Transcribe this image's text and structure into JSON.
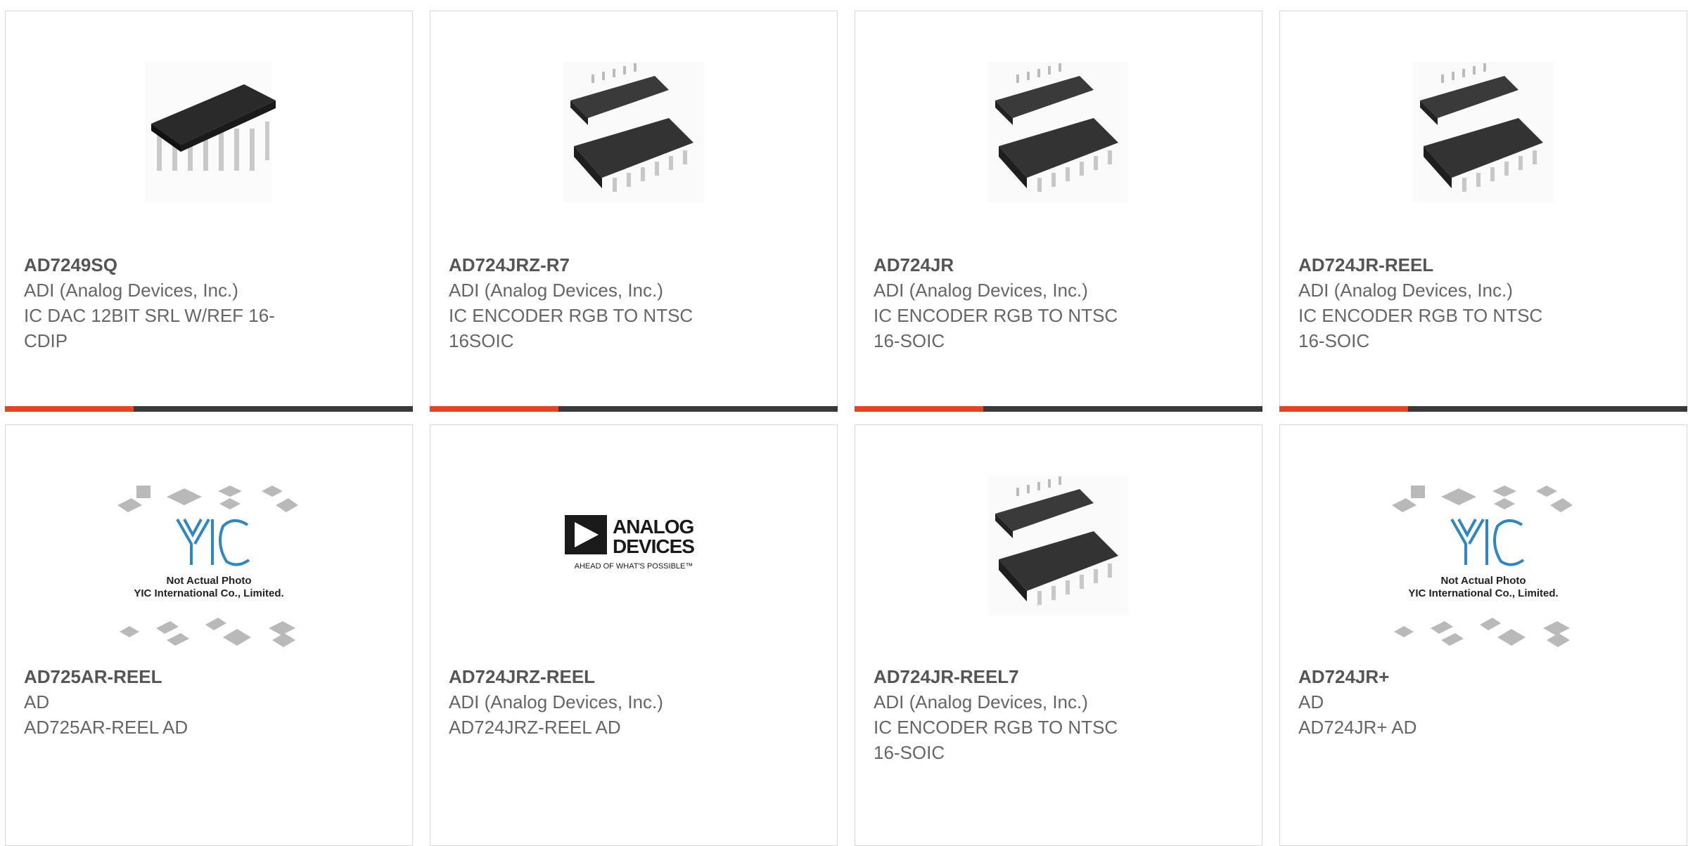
{
  "colors": {
    "accent": "#e5451e",
    "bar": "#3a3a3a",
    "border": "#d8d8d8"
  },
  "products": [
    {
      "part": "AD7249SQ",
      "maker": "ADI (Analog Devices, Inc.)",
      "desc1": "IC DAC 12BIT SRL W/REF 16-",
      "desc2": "CDIP",
      "image": "cdip-chip"
    },
    {
      "part": "AD724JRZ-R7",
      "maker": "ADI (Analog Devices, Inc.)",
      "desc1": "IC ENCODER RGB TO NTSC",
      "desc2": "16SOIC",
      "image": "soic-chips"
    },
    {
      "part": "AD724JR",
      "maker": "ADI (Analog Devices, Inc.)",
      "desc1": "IC ENCODER RGB TO NTSC",
      "desc2": "16-SOIC",
      "image": "soic-chips"
    },
    {
      "part": "AD724JR-REEL",
      "maker": "ADI (Analog Devices, Inc.)",
      "desc1": "IC ENCODER RGB TO NTSC",
      "desc2": "16-SOIC",
      "image": "soic-chips"
    },
    {
      "part": "AD725AR-REEL",
      "maker": "AD",
      "desc1": "AD725AR-REEL AD",
      "desc2": "",
      "image": "yic-placeholder",
      "placeholder_text1": "Not Actual Photo",
      "placeholder_text2": "YIC International Co., Limited.",
      "logo_text": "YIC"
    },
    {
      "part": "AD724JRZ-REEL",
      "maker": "ADI (Analog Devices, Inc.)",
      "desc1": "AD724JRZ-REEL AD",
      "desc2": "",
      "image": "analog-devices-logo",
      "logo_line1": "ANALOG",
      "logo_line2": "DEVICES",
      "logo_tagline": "AHEAD OF WHAT'S POSSIBLE™"
    },
    {
      "part": "AD724JR-REEL7",
      "maker": "ADI (Analog Devices, Inc.)",
      "desc1": "IC ENCODER RGB TO NTSC",
      "desc2": "16-SOIC",
      "image": "soic-chips"
    },
    {
      "part": "AD724JR+",
      "maker": "AD",
      "desc1": "AD724JR+ AD",
      "desc2": "",
      "image": "yic-placeholder",
      "placeholder_text1": "Not Actual Photo",
      "placeholder_text2": "YIC International Co., Limited.",
      "logo_text": "YIC"
    }
  ]
}
